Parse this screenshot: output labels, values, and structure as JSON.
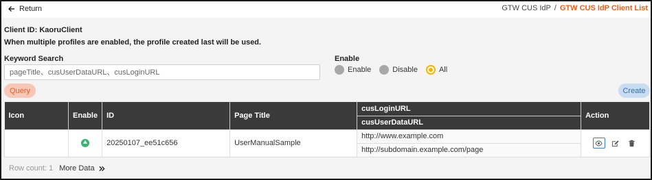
{
  "topbar": {
    "return_label": "Return",
    "breadcrumb": {
      "parent": "GTW CUS IdP",
      "separator": "/",
      "current": "GTW CUS IdP Client List"
    }
  },
  "info": {
    "client_id": "Client ID: KaoruClient",
    "note": "When multiple profiles are enabled, the profile created last will be used."
  },
  "search": {
    "label": "Keyword Search",
    "placeholder": "pageTitle、cusUserDataURL、cusLoginURL",
    "value": ""
  },
  "enable_filter": {
    "label": "Enable",
    "options": [
      "Enable",
      "Disable",
      "All"
    ],
    "selected": "All"
  },
  "buttons": {
    "query": "Query",
    "create": "Create"
  },
  "table": {
    "headers": {
      "icon": "Icon",
      "enable": "Enable",
      "id": "ID",
      "page_title": "Page Title",
      "login_url": "cusLoginURL",
      "user_data_url": "cusUserDataURL",
      "action": "Action"
    },
    "rows": [
      {
        "icon": "",
        "enabled": true,
        "id": "20250107_ee51c656",
        "page_title": "UserManualSample",
        "login_url": "http://www.example.com",
        "user_data_url": "http://subdomain.example.com/page"
      }
    ]
  },
  "footer": {
    "row_count": "Row count: 1",
    "more_data": "More Data"
  },
  "colors": {
    "accent": "#e8611a",
    "header_bg": "#3a3a3a",
    "radio_selected": "#f4b400",
    "create_bg": "#c8dcf2",
    "query_bg": "#f9c7b8",
    "enabled_green": "#3cb371"
  },
  "icons": {
    "return": "arrow-left-icon",
    "enabled": "up-arrow-circle-icon",
    "view": "eye-icon",
    "edit": "edit-icon",
    "delete": "trash-icon",
    "more": "double-chevron-right-icon"
  }
}
